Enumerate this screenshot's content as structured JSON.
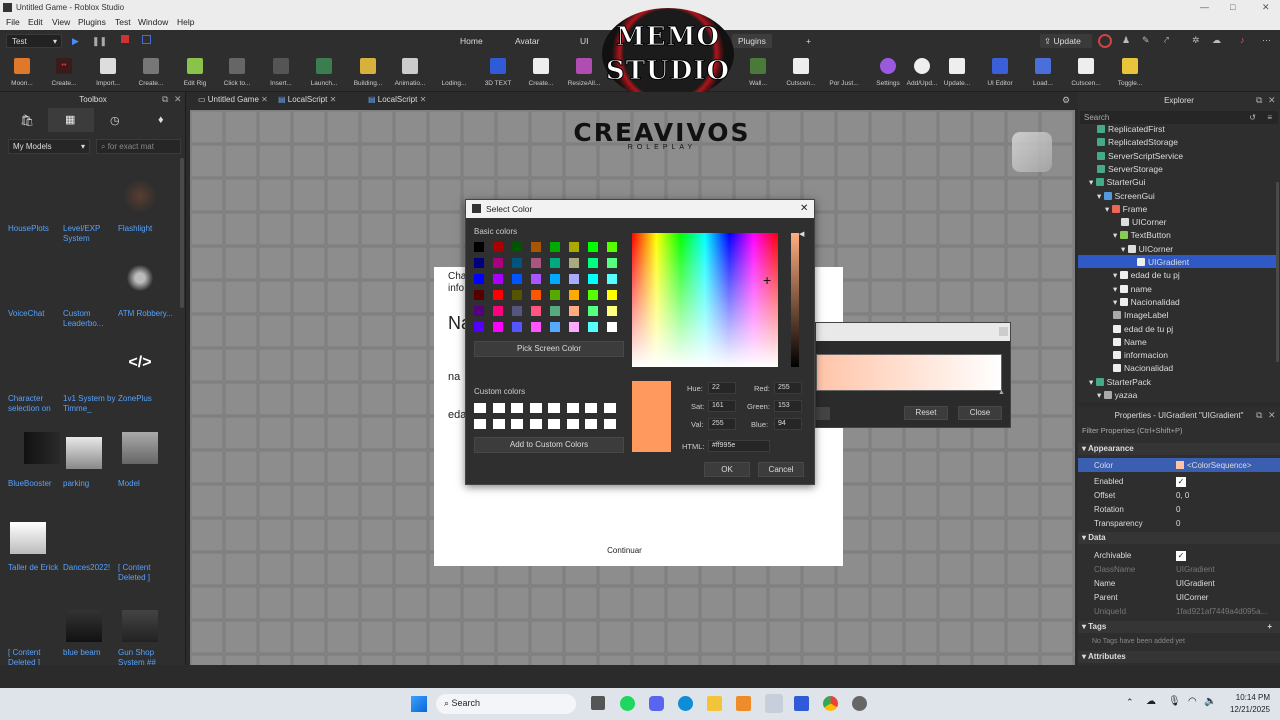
{
  "window": {
    "title": "Untitled Game - Roblox Studio",
    "controls": [
      "—",
      "□",
      "✕"
    ]
  },
  "menu": [
    "File",
    "Edit",
    "View",
    "Plugins",
    "Test",
    "Window",
    "Help"
  ],
  "toolbar": {
    "mode_select": "Test",
    "nav_tabs": [
      "Home",
      "Avatar",
      "UI",
      "Plugins",
      "+"
    ],
    "update_label": "Update",
    "plugins": [
      "Moon...",
      "Create...",
      "Import...",
      "Create...",
      "Edit Rig",
      "Click to...",
      "Insert...",
      "Launch...",
      "Building...",
      "Animatio...",
      "Loding...",
      "3D TEXT",
      "Create...",
      "ResizeAll...",
      "Wall...",
      "Cutscen...",
      "Por Just...",
      "Settings",
      "Add/Upd...",
      "Update...",
      "UI Editor",
      "Load...",
      "Cutscen...",
      "Toggle..."
    ]
  },
  "watermark": {
    "line1": "MEMO",
    "line2": "STUDIO"
  },
  "toolbox": {
    "title": "Toolbox",
    "category": "My Models",
    "search_placeholder": "for exact mat",
    "items": [
      "HousePlots",
      "Level/EXP System",
      "Flashlight",
      "VoiceChat",
      "Custom Leaderbo...",
      "ATM Robbery...",
      "Character selection on",
      "1v1 System by Timme_",
      "ZonePlus",
      "BlueBooster",
      "parking",
      "Model",
      "Taller de Erick",
      "Dances2022!",
      "[ Content Deleted ]",
      "[ Content Deleted ]",
      "blue beam",
      "Gun Shop System ##"
    ],
    "zoneplus_glyph": "</>"
  },
  "tabs": [
    "Untitled Game",
    "LocalScript",
    "LocalScript"
  ],
  "viewport": {
    "logo_main": "CREAVIVOS",
    "logo_sub": "ROLEPLAY",
    "form_partial": [
      "Cha",
      "info",
      "Na",
      "na",
      "eda"
    ],
    "continue_label": "Continuar",
    "gradient_reset": "Reset",
    "gradient_close": "Close"
  },
  "color_dialog": {
    "title": "Select Color",
    "basic_label": "Basic colors",
    "pick_screen": "Pick Screen Color",
    "custom_label": "Custom colors",
    "add_custom": "Add to Custom Colors",
    "hue_label": "Hue:",
    "hue": "22",
    "sat_label": "Sat:",
    "sat": "161",
    "val_label": "Val:",
    "val": "255",
    "red_label": "Red:",
    "red": "255",
    "green_label": "Green:",
    "green": "153",
    "blue_label": "Blue:",
    "blue": "94",
    "html_label": "HTML:",
    "html": "#ff995e",
    "ok": "OK",
    "cancel": "Cancel",
    "selected_color": "#ff995e",
    "basic_colors": [
      "#000000",
      "#aa0000",
      "#005500",
      "#aa5500",
      "#00aa00",
      "#aaaa00",
      "#00ff00",
      "#55ff00",
      "#00007f",
      "#aa007f",
      "#00557f",
      "#aa557f",
      "#00aa7f",
      "#aaaa7f",
      "#00ff7f",
      "#55ff7f",
      "#0000ff",
      "#aa00ff",
      "#0055ff",
      "#aa55ff",
      "#00aaff",
      "#aaaaff",
      "#00ffff",
      "#55ffff",
      "#550000",
      "#ff0000",
      "#555500",
      "#ff5500",
      "#55aa00",
      "#ffaa00",
      "#55ff00",
      "#ffff00",
      "#55007f",
      "#ff007f",
      "#55557f",
      "#ff557f",
      "#55aa7f",
      "#ffaa7f",
      "#55ff7f",
      "#ffff7f",
      "#5500ff",
      "#ff00ff",
      "#5555ff",
      "#ff55ff",
      "#55aaff",
      "#ffaaff",
      "#55ffff",
      "#ffffff"
    ]
  },
  "explorer": {
    "title": "Explorer",
    "search_placeholder": "Search",
    "items": [
      "ReplicatedFirst",
      "ReplicatedStorage",
      "ServerScriptService",
      "ServerStorage",
      "StarterGui",
      "ScreenGui",
      "Frame",
      "UICorner",
      "TextButton",
      "UICorner",
      "UIGradient",
      "edad de tu pj",
      "name",
      "Nacionalidad",
      "ImageLabel",
      "edad de tu pj",
      "Name",
      "informacion",
      "Nacionalidad",
      "StarterPack",
      "yazaa"
    ]
  },
  "properties": {
    "title": "Properties - UIGradient \"UIGradient\"",
    "filter_placeholder": "Filter Properties (Ctrl+Shift+P)",
    "sections": {
      "appearance": "Appearance",
      "data": "Data",
      "tags": "Tags",
      "attributes": "Attributes"
    },
    "rows": [
      {
        "name": "Color",
        "value": "<ColorSequence>"
      },
      {
        "name": "Enabled",
        "value": ""
      },
      {
        "name": "Offset",
        "value": "0, 0"
      },
      {
        "name": "Rotation",
        "value": "0"
      },
      {
        "name": "Transparency",
        "value": "0"
      },
      {
        "name": "Archivable",
        "value": ""
      },
      {
        "name": "ClassName",
        "value": "UIGradient"
      },
      {
        "name": "Name",
        "value": "UIGradient"
      },
      {
        "name": "Parent",
        "value": "UICorner"
      },
      {
        "name": "UniqueId",
        "value": "1fad921af7449a4d095a..."
      }
    ],
    "no_tags": "No Tags have been added yet"
  },
  "taskbar": {
    "search": "Search",
    "time": "10:14 PM",
    "date": "12/21/2025"
  }
}
